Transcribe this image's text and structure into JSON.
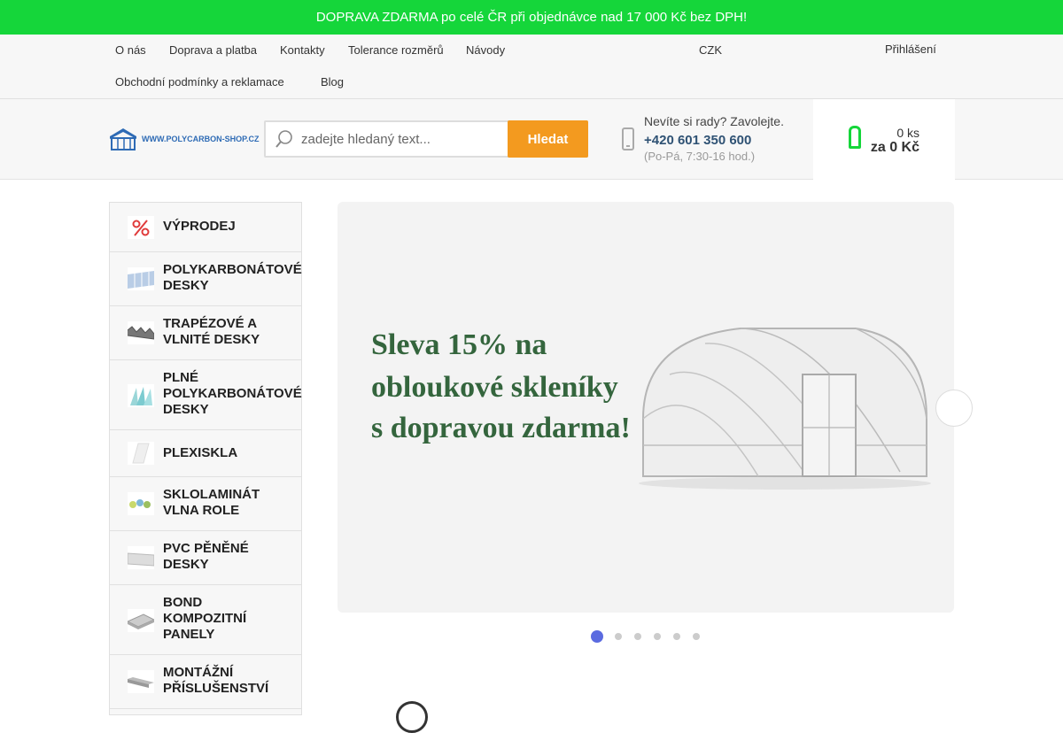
{
  "announcement": {
    "text": " DOPRAVA ZDARMA po celé ČR při objednávce nad 17 000 Kč bez DPH!",
    "close": ""
  },
  "nav": {
    "items": [
      "O nás",
      "Doprava a platba",
      "Kontakty",
      "Tolerance rozměrů",
      "Návody",
      "Obchodní podmínky a reklamace",
      "Blog"
    ],
    "caret": "",
    "currency": " CZK",
    "currency_caret": "",
    "icon_small": "",
    "login": " Přihlášení"
  },
  "header": {
    "logo_text": "WWW.POLYCARBON-SHOP.CZ",
    "search_placeholder": "zadejte hledaný text...",
    "search_button": "Hledat",
    "help_label": "Nevíte si rady? Zavolejte.",
    "phone": "+420 601 350 600",
    "hours": "(Po-Pá, 7:30-16 hod.)",
    "cart_count": "0 ks",
    "cart_total": "za 0 Kč"
  },
  "categories": [
    {
      "label": "VÝPRODEJ",
      "arrow": ""
    },
    {
      "label": "POLYKARBONÁTOVÉ\nDESKY",
      "arrow": ""
    },
    {
      "label": "TRAPÉZOVÉ A\nVLNITÉ DESKY",
      "arrow": ""
    },
    {
      "label": "PLNÉ\nPOLYKARBONÁTOVÉ\nDESKY",
      "arrow": ""
    },
    {
      "label": "PLEXISKLA",
      "arrow": ""
    },
    {
      "label": "SKLOLAMINÁT\nVLNA ROLE",
      "arrow": ""
    },
    {
      "label": "PVC PĚNĚNÉ\nDESKY",
      "arrow": ""
    },
    {
      "label": "BOND\nKOMPOZITNÍ\nPANELY",
      "arrow": ""
    },
    {
      "label": "MONTÁŽNÍ\nPŘÍSLUŠENSTVÍ",
      "arrow": ""
    }
  ],
  "slider": {
    "lines": [
      "Sleva 15% na",
      "obloukové skleníky",
      "s dopravou zdarma!"
    ],
    "next": "",
    "slide_count": 6,
    "active_index": 0
  },
  "colors": {
    "announcement_bg": "#15d63a",
    "search_button": "#f39a1f",
    "accent": "#5b6be0",
    "slide_text": "#34653d"
  }
}
